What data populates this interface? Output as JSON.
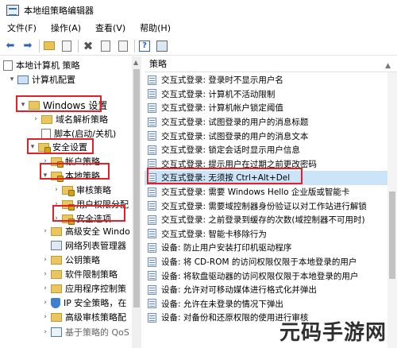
{
  "window": {
    "title": "本地组策略编辑器"
  },
  "menu": {
    "items": [
      "文件(F)",
      "操作(A)",
      "查看(V)",
      "帮助(H)"
    ]
  },
  "tree": {
    "root": "本地计算机 策略",
    "computer_config": "计算机配置",
    "windows_settings": "Windows 设置",
    "dns_policy": "域名解析策略",
    "scripts": "脚本(启动/关机)",
    "security_settings": "安全设置",
    "account_policy": "帐户策略",
    "local_policy": "本地策略",
    "audit_policy": "审核策略",
    "user_rights": "用户权限分配",
    "security_options": "安全选项",
    "advanced_firewall": "高级安全 Windo",
    "network_list": "网络列表管理器",
    "public_key": "公钥策略",
    "software_restriction": "软件限制策略",
    "app_control": "应用程序控制策",
    "ip_security": "IP 安全策略，在",
    "advanced_audit": "高级审核策略配",
    "qos": "基于策略的 QoS"
  },
  "policies": {
    "header": "策略",
    "rows": [
      "交互式登录: 登录时不显示用户名",
      "交互式登录: 计算机不活动限制",
      "交互式登录: 计算机帐户锁定阈值",
      "交互式登录: 试图登录的用户的消息标题",
      "交互式登录: 试图登录的用户的消息文本",
      "交互式登录: 锁定会话时显示用户信息",
      "交互式登录: 提示用户在过期之前更改密码",
      "交互式登录: 无须按 Ctrl+Alt+Del",
      "交互式登录: 需要 Windows Hello 企业版或智能卡",
      "交互式登录: 需要域控制器身份验证以对工作站进行解锁",
      "交互式登录: 之前登录到缓存的次数(域控制器不可用时)",
      "交互式登录: 智能卡移除行为",
      "设备: 防止用户安装打印机驱动程序",
      "设备: 将 CD-ROM 的访问权限仅限于本地登录的用户",
      "设备: 将软盘驱动器的访问权限仅限于本地登录的用户",
      "设备: 允许对可移动媒体进行格式化并弹出",
      "设备: 允许在未登录的情况下弹出",
      "设备: 对备份和还原权限的使用进行审核"
    ]
  },
  "watermark": "元码手游网",
  "colors": {
    "highlight": "#e2202a",
    "selected_row": "#cce4f7",
    "folder": "#e9c660"
  }
}
